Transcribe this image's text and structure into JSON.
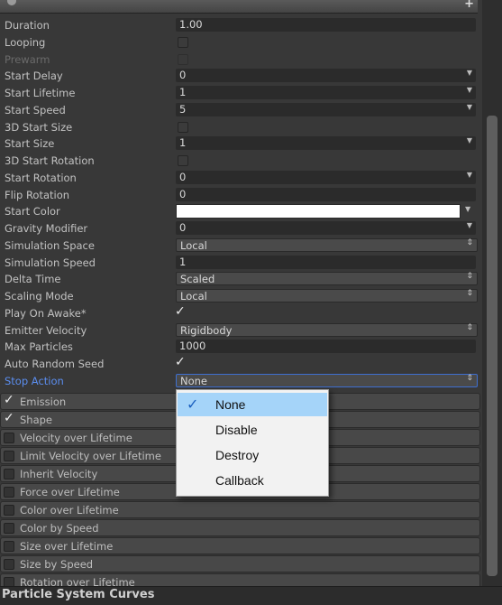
{
  "properties": [
    {
      "label": "Duration",
      "type": "number",
      "value": "1.00"
    },
    {
      "label": "Looping",
      "type": "checkbox",
      "checked": false
    },
    {
      "label": "Prewarm",
      "type": "checkbox",
      "checked": false,
      "disabled": true
    },
    {
      "label": "Start Delay",
      "type": "number-dropdown",
      "value": "0"
    },
    {
      "label": "Start Lifetime",
      "type": "number-dropdown",
      "value": "1"
    },
    {
      "label": "Start Speed",
      "type": "number-dropdown",
      "value": "5"
    },
    {
      "label": "3D Start Size",
      "type": "checkbox",
      "checked": false
    },
    {
      "label": "Start Size",
      "type": "number-dropdown",
      "value": "1"
    },
    {
      "label": "3D Start Rotation",
      "type": "checkbox",
      "checked": false
    },
    {
      "label": "Start Rotation",
      "type": "number-dropdown",
      "value": "0"
    },
    {
      "label": "Flip Rotation",
      "type": "number",
      "value": "0"
    },
    {
      "label": "Start Color",
      "type": "color",
      "value": "#ffffff"
    },
    {
      "label": "Gravity Modifier",
      "type": "number-dropdown",
      "value": "0"
    },
    {
      "label": "Simulation Space",
      "type": "popup",
      "value": "Local"
    },
    {
      "label": "Simulation Speed",
      "type": "number",
      "value": "1"
    },
    {
      "label": "Delta Time",
      "type": "popup",
      "value": "Scaled"
    },
    {
      "label": "Scaling Mode",
      "type": "popup",
      "value": "Local"
    },
    {
      "label": "Play On Awake*",
      "type": "checkbox",
      "checked": true
    },
    {
      "label": "Emitter Velocity",
      "type": "popup",
      "value": "Rigidbody"
    },
    {
      "label": "Max Particles",
      "type": "number",
      "value": "1000"
    },
    {
      "label": "Auto Random Seed",
      "type": "checkbox",
      "checked": true
    },
    {
      "label": "Stop Action",
      "type": "popup",
      "value": "None",
      "focused": true
    }
  ],
  "modules": [
    {
      "label": "Emission",
      "checked": true
    },
    {
      "label": "Shape",
      "checked": true
    },
    {
      "label": "Velocity over Lifetime",
      "checked": false
    },
    {
      "label": "Limit Velocity over Lifetime",
      "checked": false
    },
    {
      "label": "Inherit Velocity",
      "checked": false
    },
    {
      "label": "Force over Lifetime",
      "checked": false
    },
    {
      "label": "Color over Lifetime",
      "checked": false
    },
    {
      "label": "Color by Speed",
      "checked": false
    },
    {
      "label": "Size over Lifetime",
      "checked": false
    },
    {
      "label": "Size by Speed",
      "checked": false
    },
    {
      "label": "Rotation over Lifetime",
      "checked": false
    }
  ],
  "stop_action_menu": {
    "options": [
      "None",
      "Disable",
      "Destroy",
      "Callback"
    ],
    "selected": "None"
  },
  "footer": {
    "title": "Particle System Curves"
  },
  "icons": {
    "header_add": "plus-icon",
    "checkmark": "check-icon",
    "dropdown": "chevron-down-icon"
  },
  "colors": {
    "panel_bg": "#383838",
    "selected_label": "#5b8ef0",
    "menu_highlight": "#a5d4f9"
  }
}
